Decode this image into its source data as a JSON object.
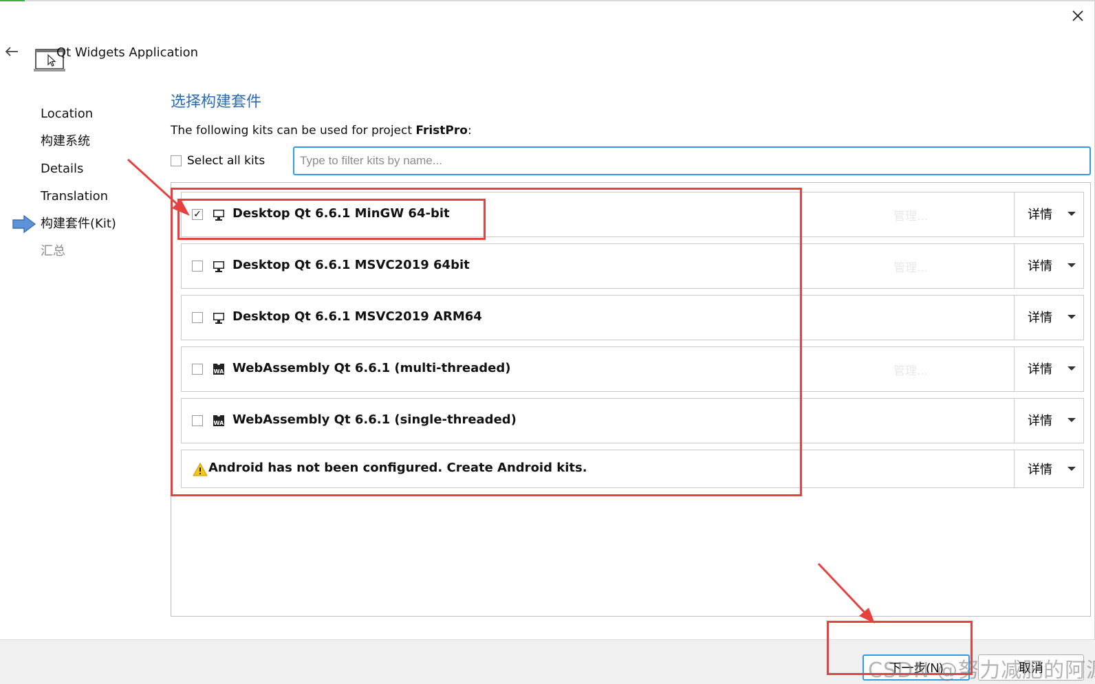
{
  "window": {
    "title": "Qt Widgets Application",
    "close_icon": "close-icon",
    "back_icon": "back-arrow-icon"
  },
  "steps": [
    {
      "label": "Location"
    },
    {
      "label": "构建系统"
    },
    {
      "label": "Details"
    },
    {
      "label": "Translation"
    },
    {
      "label": "构建套件(Kit)",
      "current": true
    },
    {
      "label": "汇总"
    }
  ],
  "page": {
    "title": "选择构建套件",
    "description_prefix": "The following kits can be used for project ",
    "project_name": "FristPro",
    "description_suffix": ":",
    "select_all_label": "Select all kits",
    "filter_placeholder": "Type to filter kits by name..."
  },
  "kits": [
    {
      "name": "Desktop Qt 6.6.1 MinGW 64-bit",
      "checked": true,
      "icon": "desktop-monitor-icon",
      "manage": "管理...",
      "details": "详情"
    },
    {
      "name": "Desktop Qt 6.6.1 MSVC2019 64bit",
      "checked": false,
      "icon": "desktop-monitor-icon",
      "manage": "管理...",
      "details": "详情"
    },
    {
      "name": "Desktop Qt 6.6.1 MSVC2019 ARM64",
      "checked": false,
      "icon": "desktop-monitor-icon",
      "manage": "",
      "details": "详情"
    },
    {
      "name": "WebAssembly Qt 6.6.1 (multi-threaded)",
      "checked": false,
      "icon": "webassembly-icon",
      "manage": "管理...",
      "details": "详情"
    },
    {
      "name": "WebAssembly Qt 6.6.1 (single-threaded)",
      "checked": false,
      "icon": "webassembly-icon",
      "manage": "",
      "details": "详情"
    }
  ],
  "android": {
    "message": "Android has not been configured. Create Android kits.",
    "icon": "warning-icon",
    "details": "详情"
  },
  "buttons": {
    "next": "下一步(N)",
    "cancel": "取消"
  },
  "watermark": "CSDN @努力减肥的阿源",
  "colors": {
    "accent": "#2f9be0",
    "title_blue": "#2a6bb8",
    "annotation_red": "#e5413e"
  }
}
